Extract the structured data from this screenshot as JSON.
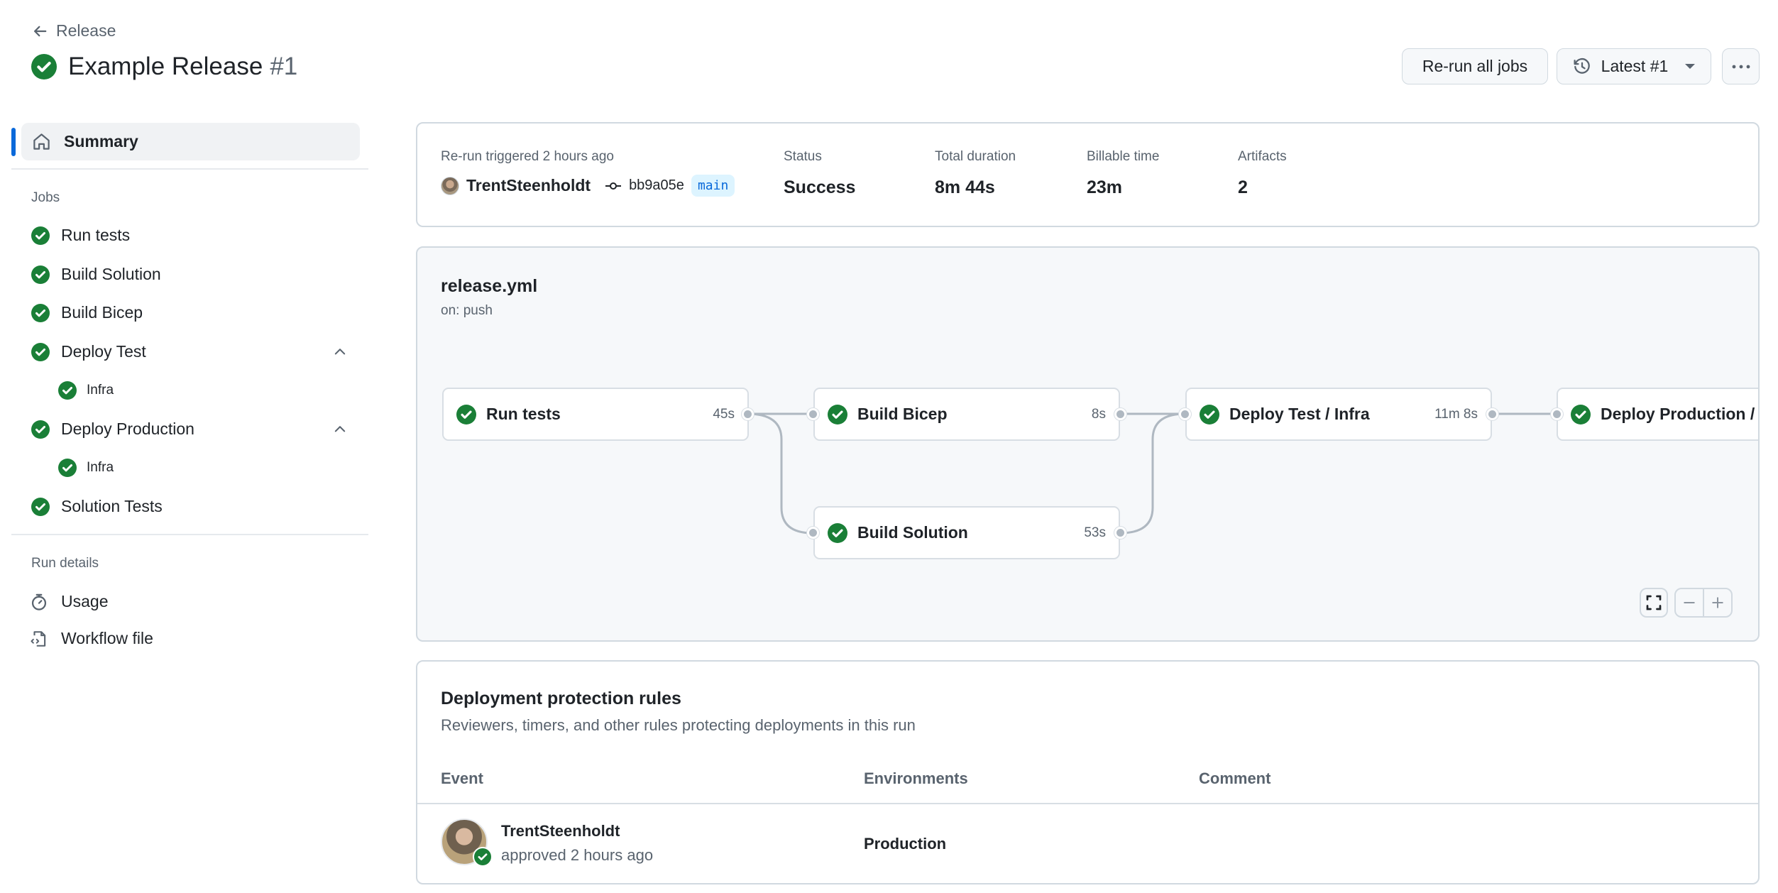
{
  "header": {
    "back_label": "Release",
    "title": "Example Release",
    "run_number": "#1",
    "status_icon": "check-circle-fill-icon",
    "buttons": {
      "rerun": "Re-run all jobs",
      "attempt": "Latest #1",
      "more": "more-options-icon"
    }
  },
  "sidebar": {
    "summary_label": "Summary",
    "jobs_heading": "Jobs",
    "jobs": [
      {
        "label": "Run tests",
        "status": "success"
      },
      {
        "label": "Build Solution",
        "status": "success"
      },
      {
        "label": "Build Bicep",
        "status": "success"
      },
      {
        "label": "Deploy Test",
        "status": "success",
        "expanded": true,
        "children": [
          {
            "label": "Infra",
            "status": "success"
          }
        ]
      },
      {
        "label": "Deploy Production",
        "status": "success",
        "expanded": true,
        "children": [
          {
            "label": "Infra",
            "status": "success"
          }
        ]
      },
      {
        "label": "Solution Tests",
        "status": "success"
      }
    ],
    "run_details_heading": "Run details",
    "run_details": [
      {
        "label": "Usage",
        "icon": "stopwatch-icon"
      },
      {
        "label": "Workflow file",
        "icon": "file-code-icon"
      }
    ]
  },
  "summary": {
    "trigger_label": "Re-run triggered 2 hours ago",
    "actor": "TrentSteenholdt",
    "commit_sha": "bb9a05e",
    "branch": "main",
    "status_label": "Status",
    "status_value": "Success",
    "duration_label": "Total duration",
    "duration_value": "8m 44s",
    "billable_label": "Billable time",
    "billable_value": "23m",
    "artifacts_label": "Artifacts",
    "artifacts_value": "2"
  },
  "workflow_graph": {
    "file": "release.yml",
    "trigger": "on: push",
    "nodes": [
      {
        "id": "run-tests",
        "label": "Run tests",
        "duration": "45s",
        "status": "success"
      },
      {
        "id": "build-bicep",
        "label": "Build Bicep",
        "duration": "8s",
        "status": "success"
      },
      {
        "id": "build-solution",
        "label": "Build Solution",
        "duration": "53s",
        "status": "success"
      },
      {
        "id": "deploy-test",
        "label": "Deploy Test / Infra",
        "duration": "11m 8s",
        "status": "success"
      },
      {
        "id": "deploy-prod",
        "label": "Deploy Production / Infra",
        "duration": "",
        "status": "success"
      }
    ],
    "edges": [
      [
        "run-tests",
        "build-bicep"
      ],
      [
        "run-tests",
        "build-solution"
      ],
      [
        "build-bicep",
        "deploy-test"
      ],
      [
        "build-solution",
        "deploy-test"
      ],
      [
        "deploy-test",
        "deploy-prod"
      ]
    ]
  },
  "protection_rules": {
    "title": "Deployment protection rules",
    "subtitle": "Reviewers, timers, and other rules protecting deployments in this run",
    "columns": [
      "Event",
      "Environments",
      "Comment"
    ],
    "rows": [
      {
        "reviewer": "TrentSteenholdt",
        "action": "approved 2 hours ago",
        "environment": "Production",
        "comment": ""
      }
    ]
  },
  "colors": {
    "success": "#1a7f37",
    "accent": "#0969da",
    "muted": "#59636e"
  }
}
